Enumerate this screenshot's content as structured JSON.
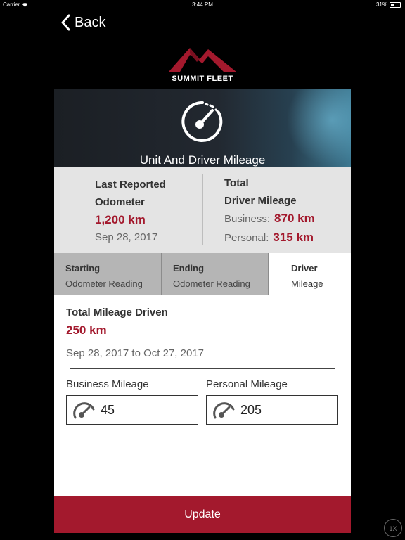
{
  "status_bar": {
    "carrier": "Carrier",
    "time": "3:44 PM",
    "battery": "31%",
    "battery_level": 0.31
  },
  "nav": {
    "back_label": "Back"
  },
  "logo": {
    "text": "SUMMIT FLEET"
  },
  "banner": {
    "title": "Unit And Driver Mileage"
  },
  "summary": {
    "odometer_label_1": "Last Reported",
    "odometer_label_2": "Odometer",
    "odometer_value": "1,200 km",
    "odometer_date": "Sep 28, 2017",
    "driver_label_1": "Total",
    "driver_label_2": "Driver Mileage",
    "business_label": "Business:",
    "business_value": "870 km",
    "personal_label": "Personal:",
    "personal_value": "315 km"
  },
  "tabs": [
    {
      "line1": "Starting",
      "line2": "Odometer Reading",
      "active": false
    },
    {
      "line1": "Ending",
      "line2": "Odometer Reading",
      "active": false
    },
    {
      "line1": "Driver",
      "line2": "Mileage",
      "active": true
    }
  ],
  "mileage": {
    "total_label": "Total Mileage Driven",
    "total_value": "250 km",
    "date_range": "Sep 28, 2017 to Oct 27, 2017",
    "business_label": "Business Mileage",
    "business_value": "45",
    "personal_label": "Personal Mileage",
    "personal_value": "205"
  },
  "actions": {
    "update_label": "Update"
  },
  "zoom": {
    "label": "1X"
  },
  "colors": {
    "accent": "#a3192d",
    "background": "#000000",
    "summary_bg": "#e4e4e4",
    "tab_inactive": "#b5b5b5"
  }
}
